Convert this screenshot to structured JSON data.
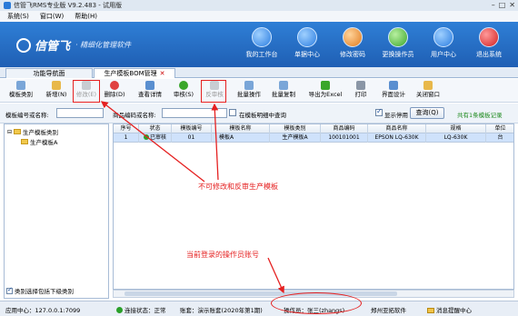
{
  "window": {
    "title": "信管飞RMS专业版 V9.2.483 - 试用版",
    "controls": [
      "–",
      "□",
      "✕"
    ]
  },
  "menu": [
    "系统(S)",
    "窗口(W)",
    "帮助(H)"
  ],
  "banner": {
    "brand": "信管飞",
    "slogan": "· 精细化管理软件",
    "nav": [
      "我的工作台",
      "单据中心",
      "修改密码",
      "更换操作员",
      "用户中心",
      "退出系统"
    ]
  },
  "tabs": [
    {
      "label": "功能导航面",
      "closable": false
    },
    {
      "label": "生产模板BOM管理",
      "closable": true,
      "close": "✕"
    }
  ],
  "toolbar": {
    "items": [
      "模板类别",
      "新增(N)",
      "修改(E)",
      "删除(D)",
      "查看详情",
      "审核(S)",
      "反审核",
      "批量操作",
      "批量复制",
      "导出为Excel",
      "打印",
      "界面设计",
      "关闭窗口"
    ]
  },
  "filter": {
    "label_template": "模板编号或名称:",
    "label_product": "商品编码或名称:",
    "check_detail": "在模板明细中查询",
    "check_show_disabled": "显示停用",
    "query_button": "查询(Q)",
    "count_text": "共有1条模板记录"
  },
  "tree": {
    "root": "生产模板类别",
    "child": "生产模板A",
    "footer": "类别选择包括下级类别"
  },
  "grid": {
    "headers": [
      "序号",
      "状态",
      "模板编号",
      "模板名称",
      "模板类别",
      "商品编码",
      "商品名称",
      "规格",
      "单位"
    ],
    "rows": [
      [
        "1",
        "已审核",
        "01",
        "模板A",
        "生产模板A",
        "100101001",
        "EPSON LQ-630K",
        "LQ-630K",
        "台"
      ]
    ]
  },
  "statusbar": {
    "app_center": "应用中心：127.0.0.1:7099",
    "connection": "连接状态：正常",
    "account": "账套：演示账套(2020年第1期)",
    "operator": "操作员：张三(zhangs)",
    "company": "郑州亚拓软件",
    "message": "消息提醒中心"
  },
  "annotations": {
    "callout_disabled": "不可修改和反审生产模板",
    "callout_operator": "当前登录的操作员账号"
  },
  "colors": {
    "accent": "#2f7fd6",
    "annotation": "#e52020",
    "ok": "#2aa02a"
  }
}
